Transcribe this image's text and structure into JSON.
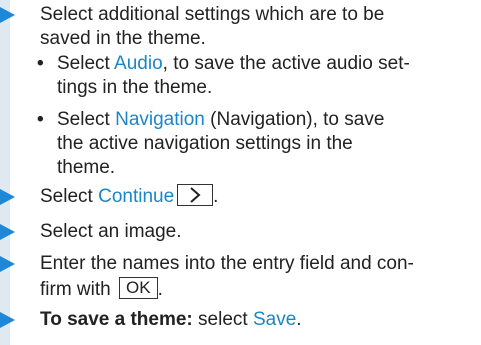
{
  "steps": [
    {
      "line1": "Select additional settings which are to be",
      "line2": "saved in the theme.",
      "subitems": [
        {
          "link": "Audio",
          "line1_rest": ", to save the active audio set-",
          "line2": "tings in the theme."
        },
        {
          "link": "Navigation",
          "line1_rest": " (Navigation), to save",
          "line2": "the active navigation settings in the",
          "line3": "theme."
        }
      ]
    },
    {
      "prefix": "Select ",
      "link": "Continue",
      "suffix": "."
    },
    {
      "text": "Select an image."
    },
    {
      "line1": "Enter the names into the entry field and con-",
      "line2_prefix": "firm with ",
      "key_label": "OK",
      "line2_suffix": "."
    },
    {
      "bold": "To save a theme:",
      "middle": " select ",
      "link": "Save",
      "suffix": "."
    }
  ],
  "colors": {
    "arrow": "#1e88d6",
    "link": "#1a86c8",
    "band": "#dfe9f2"
  },
  "icons": {
    "step_marker": "triangle-arrow-icon",
    "continue_key": "chevron-right-icon"
  }
}
